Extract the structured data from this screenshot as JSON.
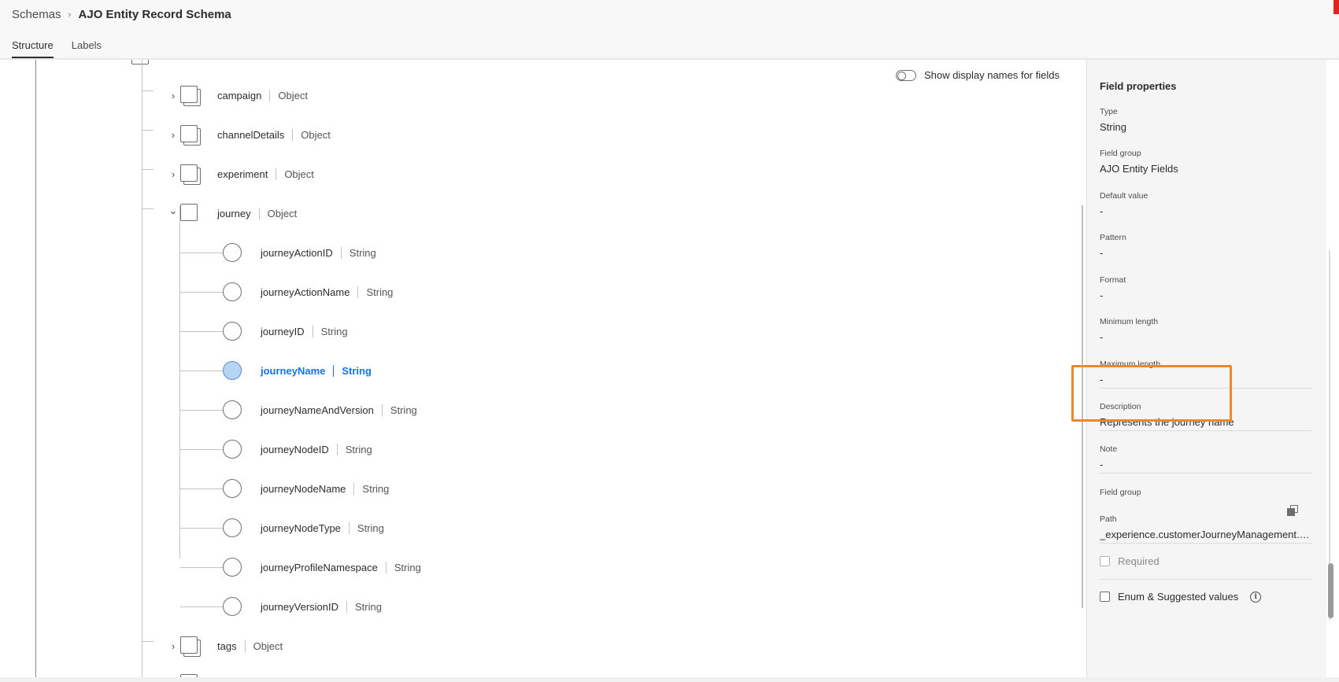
{
  "breadcrumb": {
    "parent": "Schemas",
    "separator": "›",
    "current": "AJO Entity Record Schema"
  },
  "tabs": [
    {
      "label": "Structure",
      "active": true
    },
    {
      "label": "Labels",
      "active": false
    }
  ],
  "toggle": {
    "label": "Show display names for fields",
    "on": false
  },
  "tree": {
    "objects_top": [
      {
        "name": "campaign",
        "type": "Object"
      },
      {
        "name": "channelDetails",
        "type": "Object"
      },
      {
        "name": "experiment",
        "type": "Object"
      },
      {
        "name": "journey",
        "type": "Object"
      }
    ],
    "journey_fields": [
      {
        "name": "journeyActionID",
        "type": "String",
        "selected": false
      },
      {
        "name": "journeyActionName",
        "type": "String",
        "selected": false
      },
      {
        "name": "journeyID",
        "type": "String",
        "selected": false
      },
      {
        "name": "journeyName",
        "type": "String",
        "selected": true
      },
      {
        "name": "journeyNameAndVersion",
        "type": "String",
        "selected": false
      },
      {
        "name": "journeyNodeID",
        "type": "String",
        "selected": false
      },
      {
        "name": "journeyNodeName",
        "type": "String",
        "selected": false
      },
      {
        "name": "journeyNodeType",
        "type": "String",
        "selected": false
      },
      {
        "name": "journeyProfileNamespace",
        "type": "String",
        "selected": false
      },
      {
        "name": "journeyVersionID",
        "type": "String",
        "selected": false
      }
    ],
    "objects_bottom": [
      {
        "name": "tags",
        "type": "Object"
      }
    ]
  },
  "panel": {
    "title": "Field properties",
    "type_label": "Type",
    "type_value": "String",
    "group_label": "Field group",
    "group_value": "AJO Entity Fields",
    "default_label": "Default value",
    "default_value": "-",
    "pattern_label": "Pattern",
    "pattern_value": "-",
    "format_label": "Format",
    "format_value": "-",
    "minlen_label": "Minimum length",
    "minlen_value": "-",
    "maxlen_label": "Maximum length",
    "maxlen_value": "-",
    "desc_label": "Description",
    "desc_value": "Represents the journey name",
    "note_label": "Note",
    "note_value": "-",
    "group2_label": "Field group",
    "path_label": "Path",
    "path_value": "_experience.customerJourneyManagement.ent...",
    "required_label": "Required",
    "enum_label": "Enum & Suggested values"
  },
  "colors": {
    "accent": "#1473e6",
    "highlight": "#e8892f",
    "selected_fill": "#b8d4f3"
  },
  "icons": [
    "chevron-right-icon",
    "chevron-down-icon",
    "object-icon",
    "field-circle-icon",
    "copy-icon",
    "info-icon"
  ]
}
